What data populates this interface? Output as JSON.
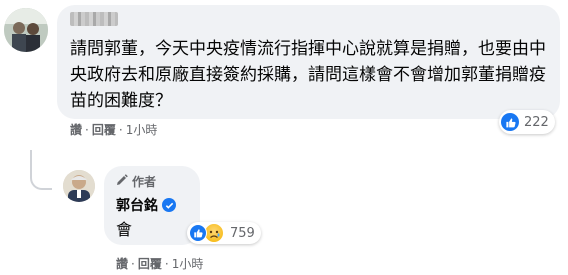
{
  "comment": {
    "author_name_redacted": "",
    "text": "請問郭董，今天中央疫情流行指揮中心說就算是捐贈，也要由中央政府去和原廠直接簽約採購，請問這樣會不會增加郭董捐贈疫苗的困難度？",
    "reaction_count": "222",
    "actions": {
      "like": "讚",
      "reply": "回覆",
      "time": "1小時"
    }
  },
  "reply": {
    "badge": "作者",
    "author": "郭台銘",
    "text": "會",
    "reaction_count": "759",
    "actions": {
      "like": "讚",
      "reply": "回覆",
      "time": "1小時"
    }
  },
  "colors": {
    "bubble": "#f0f2f5",
    "secondary_text": "#65676b",
    "like_blue": "#1877f2",
    "sad_yellow": "#f7b928"
  },
  "icons": {
    "like": "thumbs-up-icon",
    "sad": "sad-face-icon",
    "verified": "verified-badge-icon",
    "author_badge": "pencil-icon"
  }
}
